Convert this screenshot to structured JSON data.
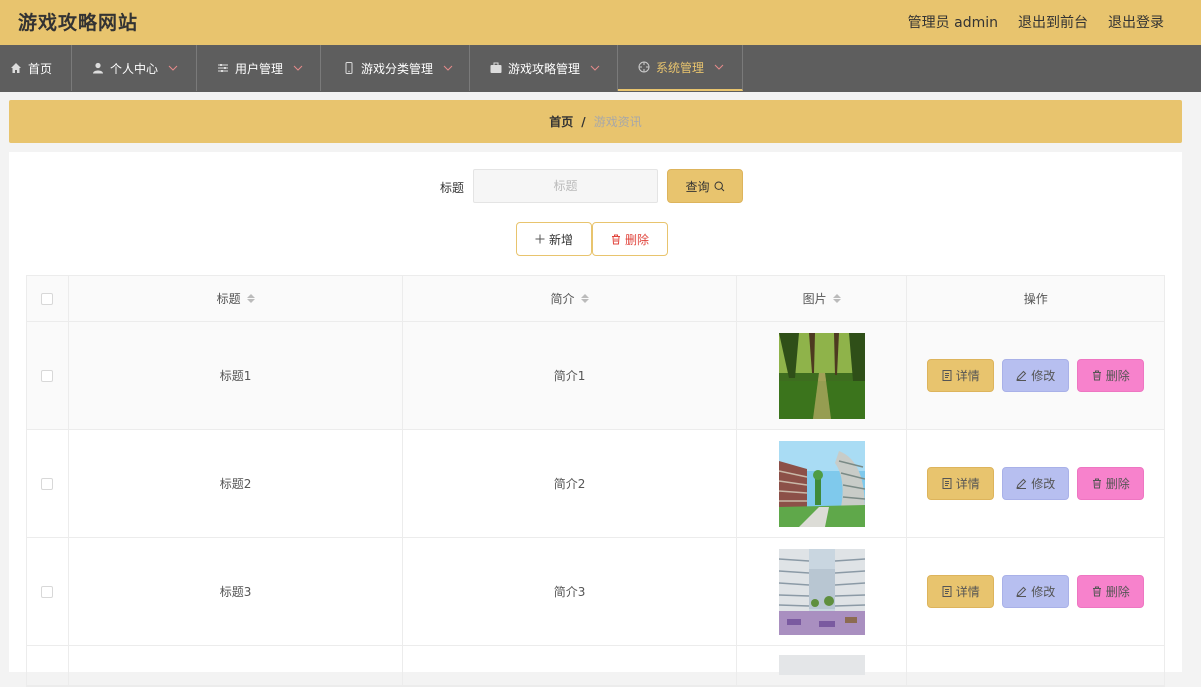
{
  "header": {
    "site_title": "游戏攻略网站",
    "admin_label": "管理员 admin",
    "to_front_label": "退出到前台",
    "logout_label": "退出登录"
  },
  "nav": {
    "items": [
      {
        "label": "首页",
        "icon": "home-icon",
        "dropdown": false,
        "active": false
      },
      {
        "label": "个人中心",
        "icon": "user-icon",
        "dropdown": true,
        "active": false
      },
      {
        "label": "用户管理",
        "icon": "sliders-icon",
        "dropdown": true,
        "active": false
      },
      {
        "label": "游戏分类管理",
        "icon": "mobile-icon",
        "dropdown": true,
        "active": false
      },
      {
        "label": "游戏攻略管理",
        "icon": "briefcase-icon",
        "dropdown": true,
        "active": false
      },
      {
        "label": "系统管理",
        "icon": "crosshair-icon",
        "dropdown": true,
        "active": true
      }
    ]
  },
  "breadcrumb": {
    "home": "首页",
    "separator": "/",
    "current": "游戏资讯"
  },
  "search": {
    "label": "标题",
    "placeholder": "标题",
    "button_label": "查询"
  },
  "actions": {
    "add_label": "新增",
    "delete_label": "删除"
  },
  "table": {
    "columns": {
      "title": "标题",
      "desc": "简介",
      "image": "图片",
      "ops": "操作"
    },
    "rows": [
      {
        "title": "标题1",
        "desc": "简介1",
        "image": "forest-path"
      },
      {
        "title": "标题2",
        "desc": "简介2",
        "image": "campus-building"
      },
      {
        "title": "标题3",
        "desc": "简介3",
        "image": "courtyard-plaza"
      }
    ],
    "row_actions": {
      "detail": "详情",
      "edit": "修改",
      "delete": "删除"
    }
  },
  "colors": {
    "accent": "#e8c46e",
    "navbar": "#5e5e5e",
    "edit": "#b7bff0",
    "delete": "#f782cc",
    "danger_text": "#e0443c"
  }
}
